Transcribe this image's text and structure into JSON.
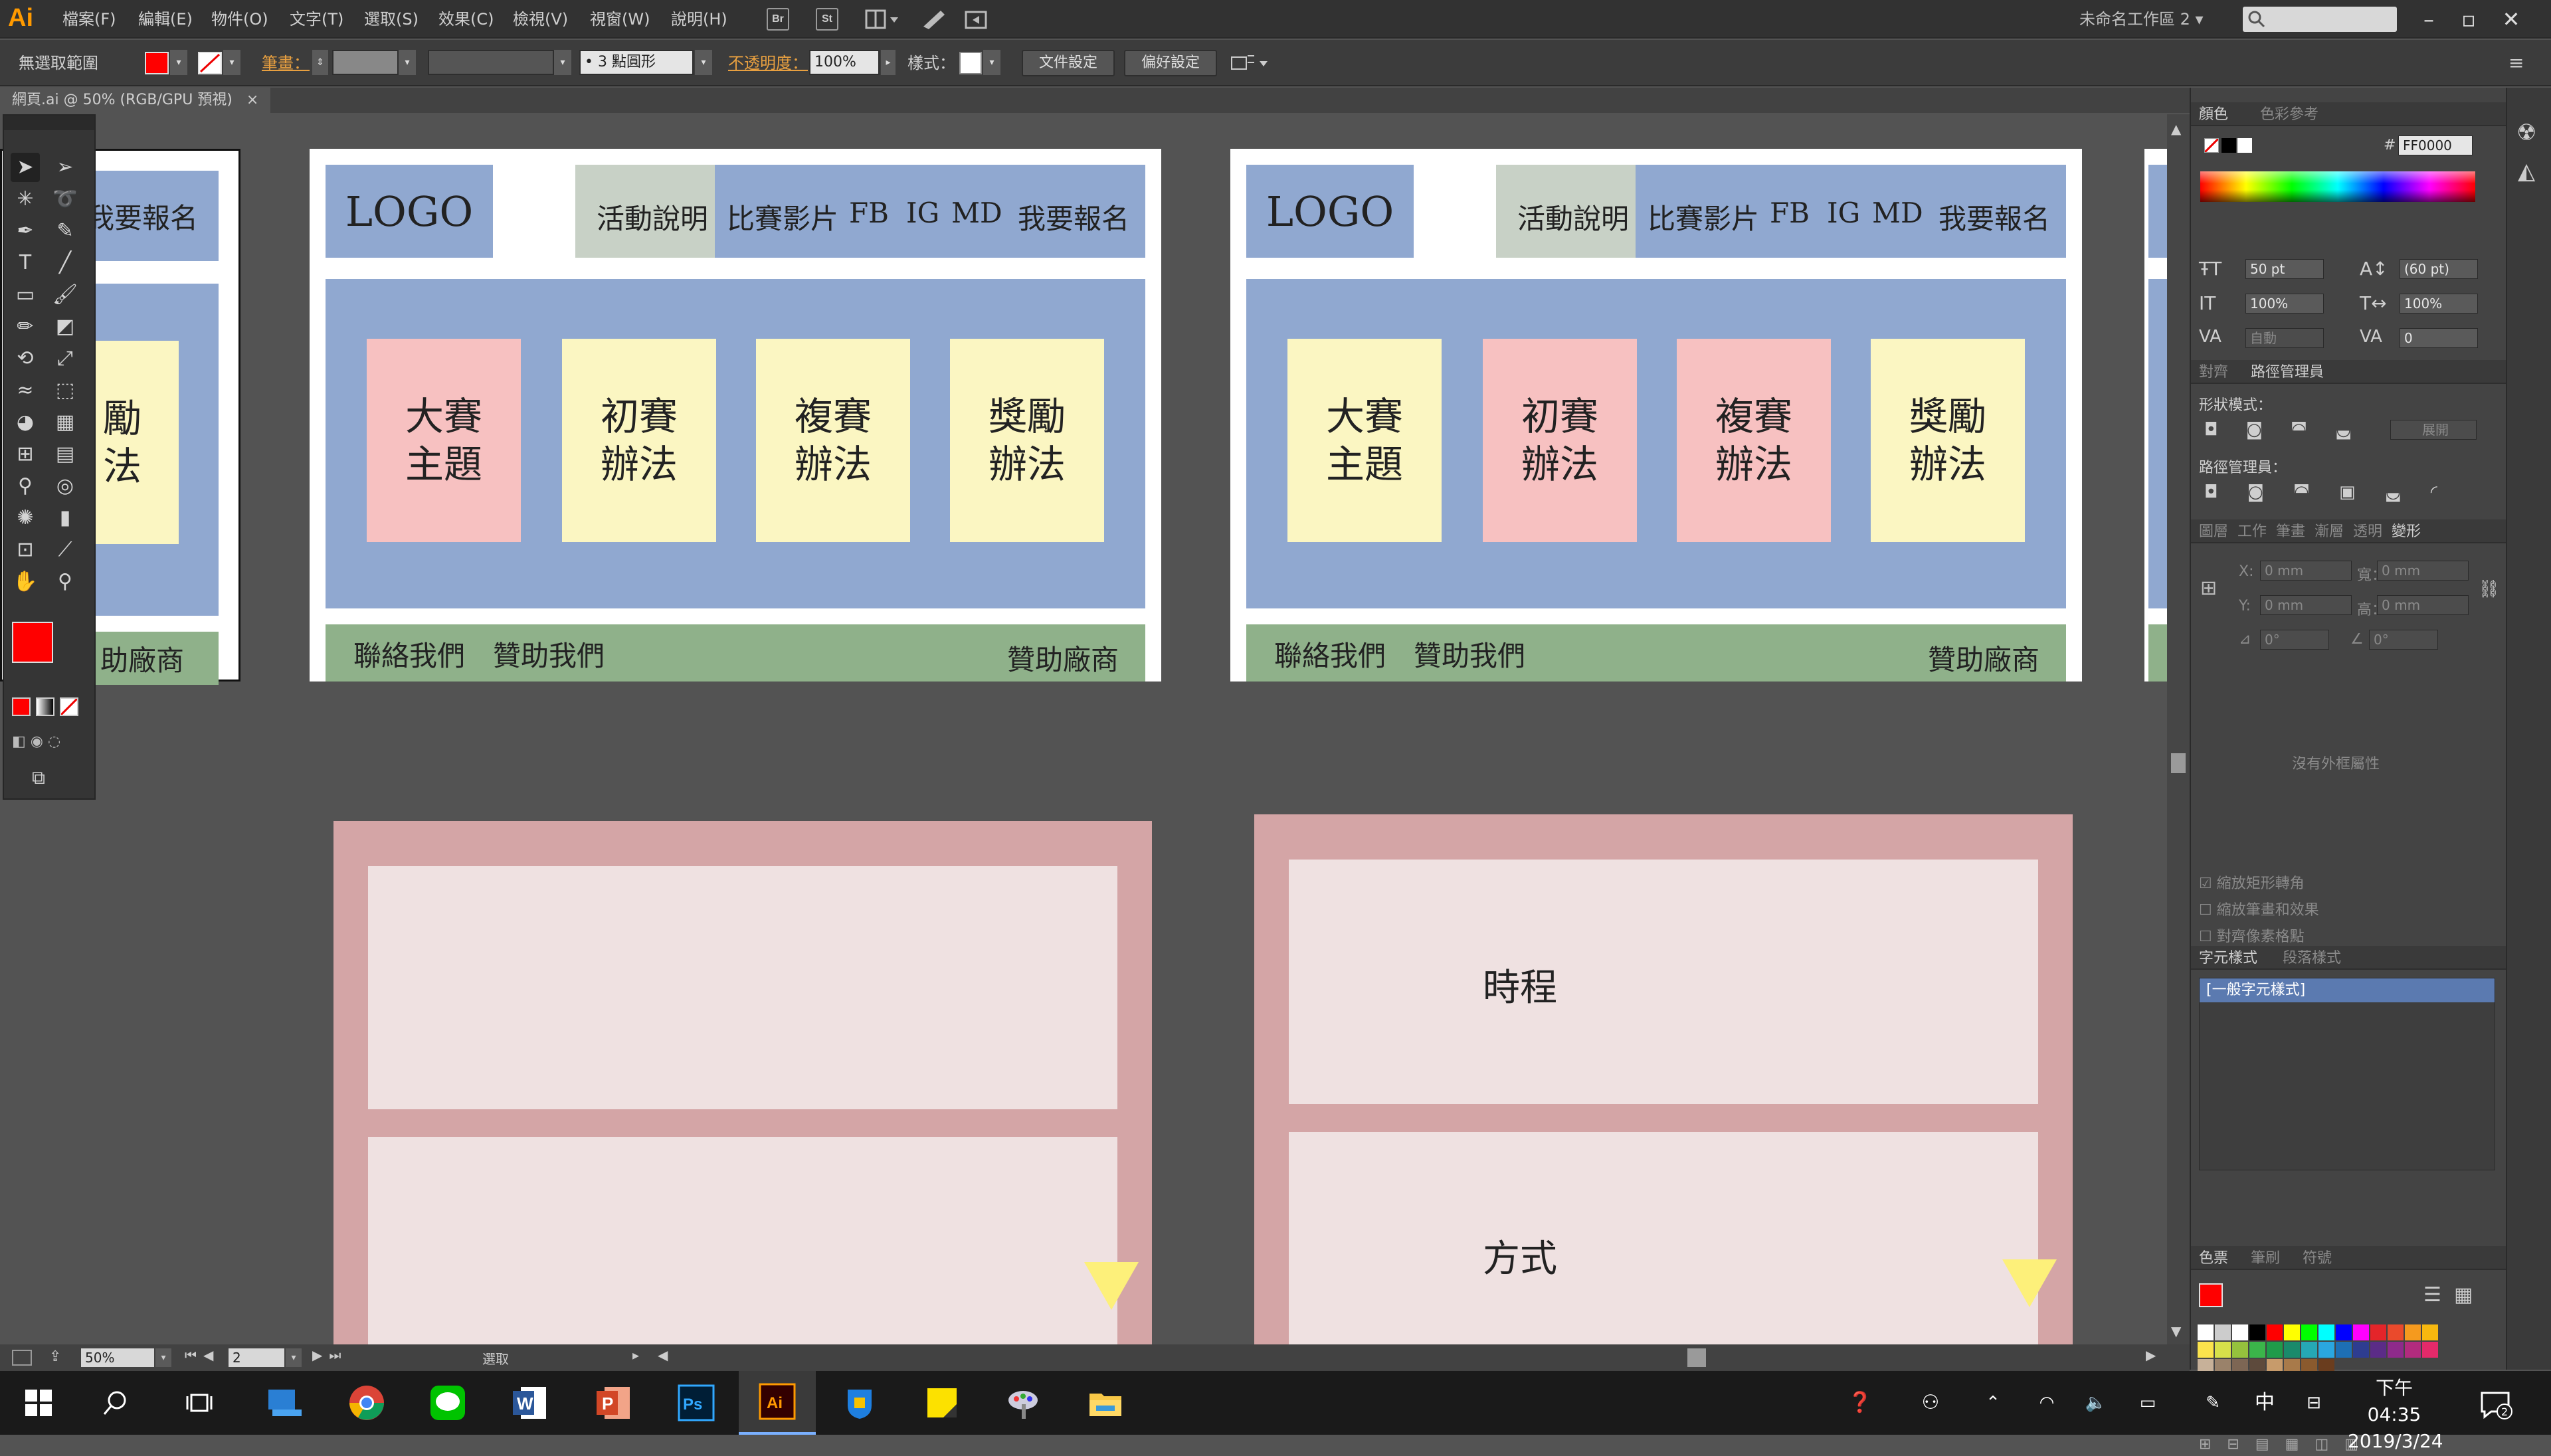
{
  "app": {
    "logo": "Ai",
    "workspace": "未命名工作區 2 ▾"
  },
  "menu": [
    "檔案(F)",
    "編輯(E)",
    "物件(O)",
    "文字(T)",
    "選取(S)",
    "效果(C)",
    "檢視(V)",
    "視窗(W)",
    "說明(H)"
  ],
  "toolbar_icons": {
    "br": "Br",
    "st": "St"
  },
  "control": {
    "selection": "無選取範圍",
    "stroke_label": "筆畫：",
    "brush": "3 點圓形",
    "opacity_label": "不透明度：",
    "opacity": "100%",
    "style_label": "樣式：",
    "doc_setup": "文件設定",
    "preferences": "偏好設定"
  },
  "doc_tab": "網頁.ai @ 50% (RGB/GPU 預視)",
  "doc_tab_close": "×",
  "artboard_text": {
    "logo": "LOGO",
    "nav": [
      "活動說明",
      "比賽影片",
      "FB",
      "IG",
      "MD",
      "我要報名"
    ],
    "cards": [
      "大賽\n主題",
      "初賽\n辦法",
      "複賽\n辦法",
      "獎勵\n辦法"
    ],
    "footer_left": [
      "聯絡我們",
      "贊助我們"
    ],
    "footer_right": "贊助廠商",
    "partial_nav": "我要報名",
    "partial_card": "勵\n法",
    "partial_footer": "助廠商",
    "schedule": "時程",
    "method": "方式"
  },
  "colors": {
    "blue": "#90a8d0",
    "green": "#8fb18a",
    "grey_nav": "#c8d1c6",
    "pink_card": "#f7c1c1",
    "yellow_card": "#fbf6c2",
    "mauve": "#d4a5a6",
    "pale": "#efe1e1",
    "fill": "#ff0000",
    "ai_orange": "#ff9a00"
  },
  "panel": {
    "color_tabs": [
      "顏色",
      "色彩參考"
    ],
    "hex_label": "#",
    "hex": "FF0000",
    "char": {
      "size": "50 pt",
      "leading": "(60 pt)",
      "vscale": "100%",
      "hscale": "100%",
      "kern": "自動",
      "track": "0"
    },
    "pathfinder_tabs": [
      "對齊",
      "路徑管理員"
    ],
    "shape_modes": "形狀模式：",
    "expand": "展開",
    "pathfinders": "路徑管理員：",
    "transform_tabs": [
      "圖層",
      "工作",
      "筆畫",
      "漸層",
      "透明",
      "變形"
    ],
    "x": "0 mm",
    "y": "0 mm",
    "w": "0 mm",
    "h": "0 mm",
    "angle": "0°",
    "shear": "0°",
    "x_label": "X:",
    "y_label": "Y:",
    "w_label": "寬：",
    "h_label": "高：",
    "no_attr": "沒有外框屬性",
    "checks": [
      "縮放矩形轉角",
      "縮放筆畫和效果",
      "對齊像素格點"
    ],
    "charstyle_tabs": [
      "字元樣式",
      "段落樣式"
    ],
    "charstyle_item": "[一般字元樣式]",
    "swatch_tabs": [
      "色票",
      "筆刷",
      "符號"
    ]
  },
  "status": {
    "zoom": "50%",
    "artboard": "2",
    "tool": "選取"
  },
  "taskbar": {
    "ime": "中",
    "time": "下午 04:35",
    "date": "2019/3/24",
    "notif": "2"
  }
}
